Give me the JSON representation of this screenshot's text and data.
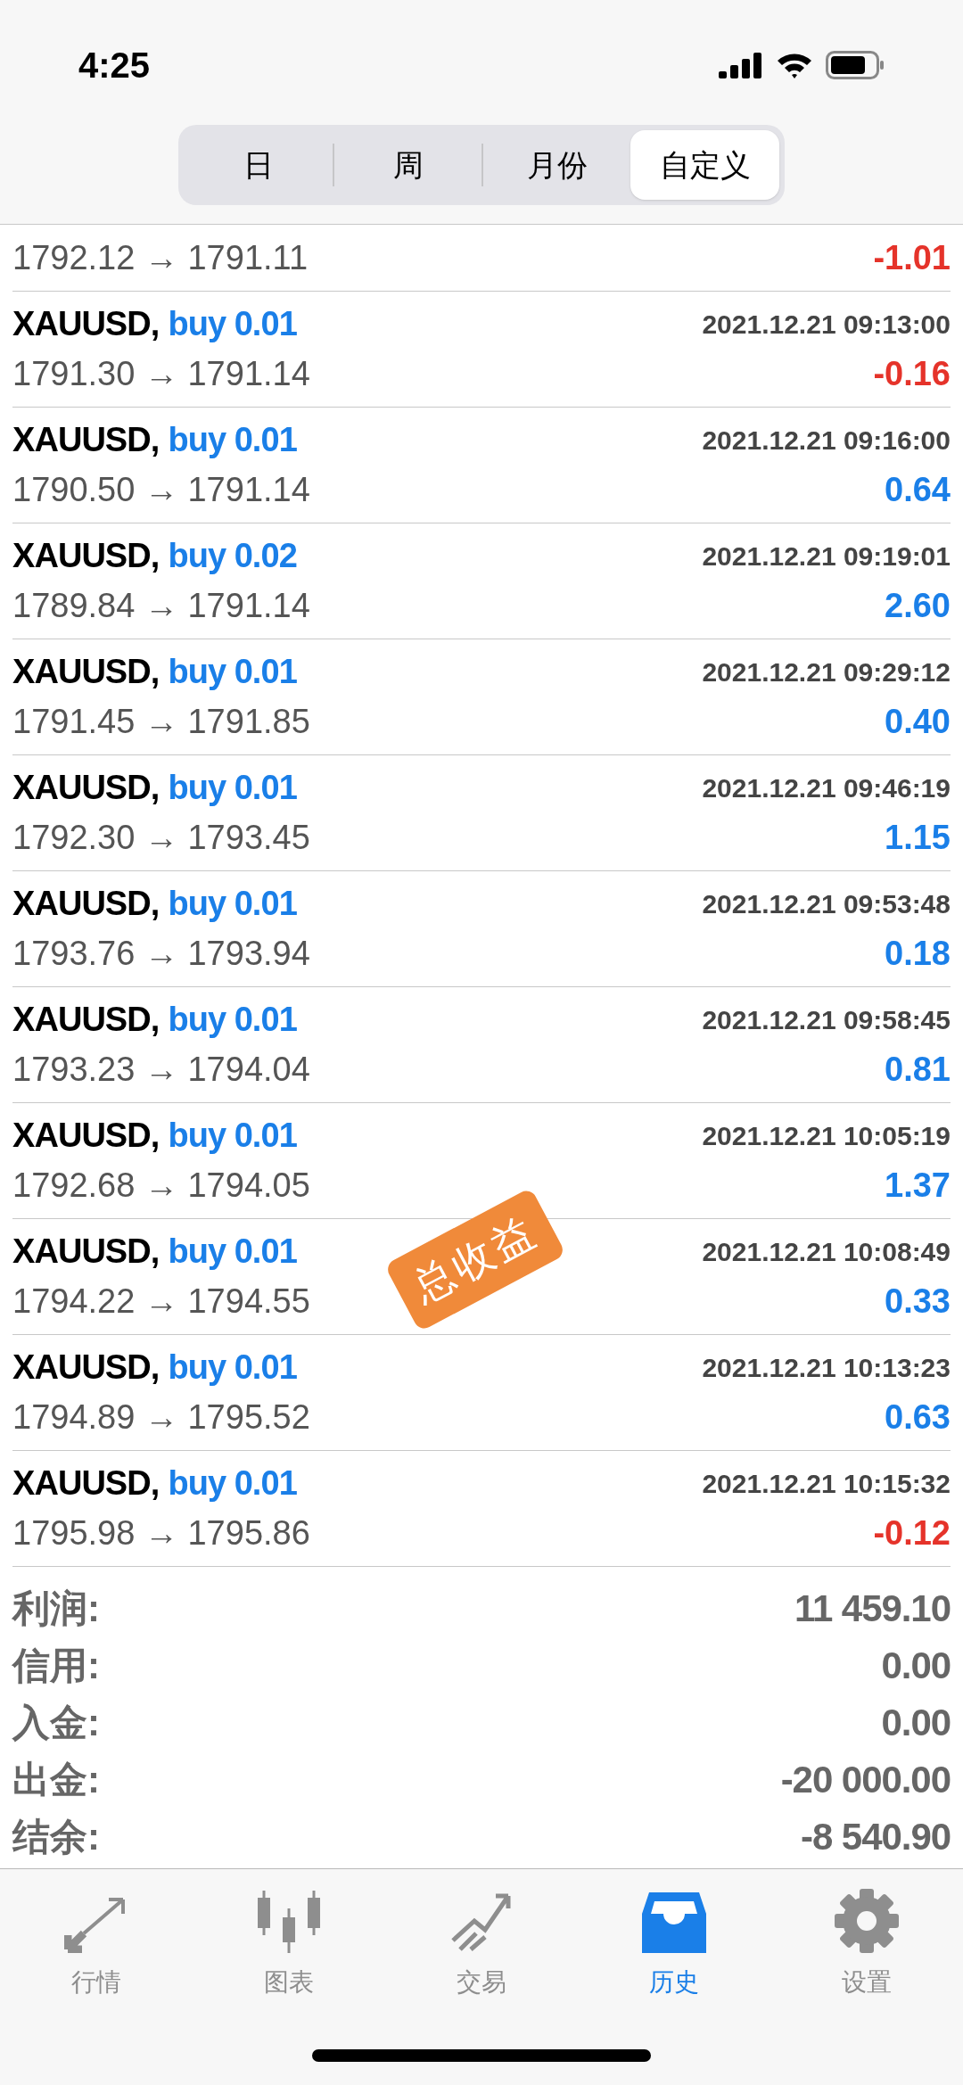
{
  "status_bar": {
    "time": "4:25"
  },
  "period_tabs": [
    {
      "label": "日",
      "selected": false
    },
    {
      "label": "周",
      "selected": false
    },
    {
      "label": "月份",
      "selected": false
    },
    {
      "label": "自定义",
      "selected": true
    }
  ],
  "deals": [
    {
      "prices": "1792.12 → 1791.11",
      "profit": "-1.01",
      "loss": true
    },
    {
      "symbol": "XAUUSD,",
      "order": "buy 0.01",
      "time": "2021.12.21 09:13:00",
      "prices": "1791.30 → 1791.14",
      "profit": "-0.16",
      "loss": true
    },
    {
      "symbol": "XAUUSD,",
      "order": "buy 0.01",
      "time": "2021.12.21 09:16:00",
      "prices": "1790.50 → 1791.14",
      "profit": "0.64",
      "loss": false
    },
    {
      "symbol": "XAUUSD,",
      "order": "buy 0.02",
      "time": "2021.12.21 09:19:01",
      "prices": "1789.84 → 1791.14",
      "profit": "2.60",
      "loss": false
    },
    {
      "symbol": "XAUUSD,",
      "order": "buy 0.01",
      "time": "2021.12.21 09:29:12",
      "prices": "1791.45 → 1791.85",
      "profit": "0.40",
      "loss": false
    },
    {
      "symbol": "XAUUSD,",
      "order": "buy 0.01",
      "time": "2021.12.21 09:46:19",
      "prices": "1792.30 → 1793.45",
      "profit": "1.15",
      "loss": false
    },
    {
      "symbol": "XAUUSD,",
      "order": "buy 0.01",
      "time": "2021.12.21 09:53:48",
      "prices": "1793.76 → 1793.94",
      "profit": "0.18",
      "loss": false
    },
    {
      "symbol": "XAUUSD,",
      "order": "buy 0.01",
      "time": "2021.12.21 09:58:45",
      "prices": "1793.23 → 1794.04",
      "profit": "0.81",
      "loss": false
    },
    {
      "symbol": "XAUUSD,",
      "order": "buy 0.01",
      "time": "2021.12.21 10:05:19",
      "prices": "1792.68 → 1794.05",
      "profit": "1.37",
      "loss": false
    },
    {
      "symbol": "XAUUSD,",
      "order": "buy 0.01",
      "time": "2021.12.21 10:08:49",
      "prices": "1794.22 → 1794.55",
      "profit": "0.33",
      "loss": false
    },
    {
      "symbol": "XAUUSD,",
      "order": "buy 0.01",
      "time": "2021.12.21 10:13:23",
      "prices": "1794.89 → 1795.52",
      "profit": "0.63",
      "loss": false
    },
    {
      "symbol": "XAUUSD,",
      "order": "buy 0.01",
      "time": "2021.12.21 10:15:32",
      "prices": "1795.98 → 1795.86",
      "profit": "-0.12",
      "loss": true
    }
  ],
  "sticker": {
    "text": "总收益"
  },
  "summary": [
    {
      "label": "利润:",
      "value": "11 459.10"
    },
    {
      "label": "信用:",
      "value": "0.00"
    },
    {
      "label": "入金:",
      "value": "0.00"
    },
    {
      "label": "出金:",
      "value": "-20 000.00"
    },
    {
      "label": "结余:",
      "value": "-8 540.90"
    }
  ],
  "tab_bar": [
    {
      "kind": "quotes",
      "label": "行情",
      "selected": false
    },
    {
      "kind": "chart",
      "label": "图表",
      "selected": false
    },
    {
      "kind": "trade",
      "label": "交易",
      "selected": false
    },
    {
      "kind": "history",
      "label": "历史",
      "selected": true
    },
    {
      "kind": "settings",
      "label": "设置",
      "selected": false
    }
  ]
}
